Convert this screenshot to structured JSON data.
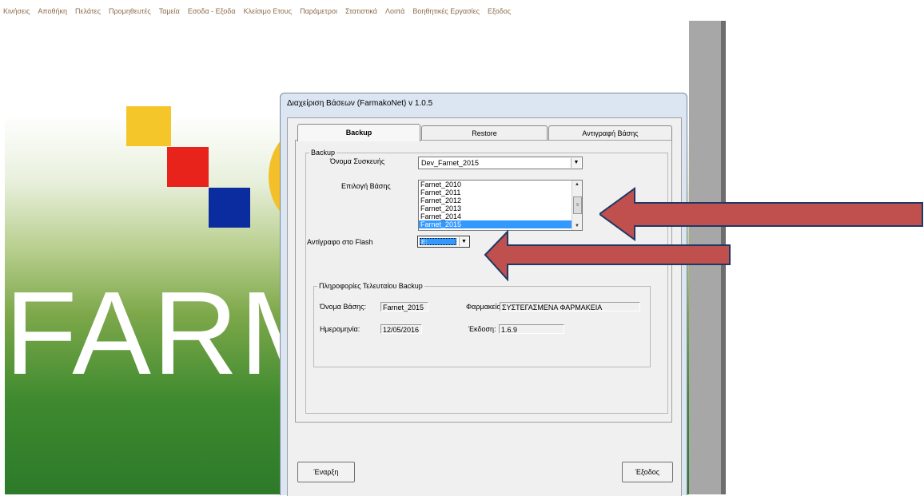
{
  "menu": [
    "Κινήσεις",
    "Αποθήκη",
    "Πελάτες",
    "Προμηθευτές",
    "Ταμεία",
    "Εσοδα - Εξοδα",
    "Κλείσιμο Ετους",
    "Παράμετροι",
    "Στατιστικά",
    "Λοιπά",
    "Βοηθητικές Εργασίες",
    "Εξοδος"
  ],
  "background": {
    "logo_text": "FARM"
  },
  "dialog": {
    "title": "Διαχείριση Βάσεων (FarmakoNet) v 1.0.5",
    "tabs": [
      "Backup",
      "Restore",
      "Αντιγραφή Βάσης"
    ],
    "active_tab": "Backup",
    "backup_group": {
      "legend": "Backup",
      "device_label": "Όνομα Συσκευής",
      "device_value": "Dev_Farnet_2015",
      "db_label": "Επιλογή Βάσης",
      "db_options": [
        "Farnet_2010",
        "Farnet_2011",
        "Farnet_2012",
        "Farnet_2013",
        "Farnet_2014",
        "Farnet_2015"
      ],
      "db_selected": "Farnet_2015",
      "flash_label": "Αντίγραφο στο Flash",
      "flash_value": "E:"
    },
    "last_backup": {
      "legend": "Πληροφορίες Τελευταίου Backup",
      "db_name_label": "Όνομα Βάσης:",
      "db_name_value": "Farnet_2015",
      "pharmacy_label": "Φαρμακείο",
      "pharmacy_value": "ΣΥΣΤΕΓΑΣΜΕΝΑ ΦΑΡΜΑΚΕΙΑ",
      "date_label": "Ημερομηνία:",
      "date_value": "12/05/2016",
      "version_label": "Έκδοση:",
      "version_value": "1.6.9"
    },
    "start_button": "Έναρξη",
    "exit_button": "Έξοδος"
  },
  "colors": {
    "arrow_fill": "#c0504d",
    "arrow_stroke": "#1f3864",
    "selection": "#3399ff"
  }
}
